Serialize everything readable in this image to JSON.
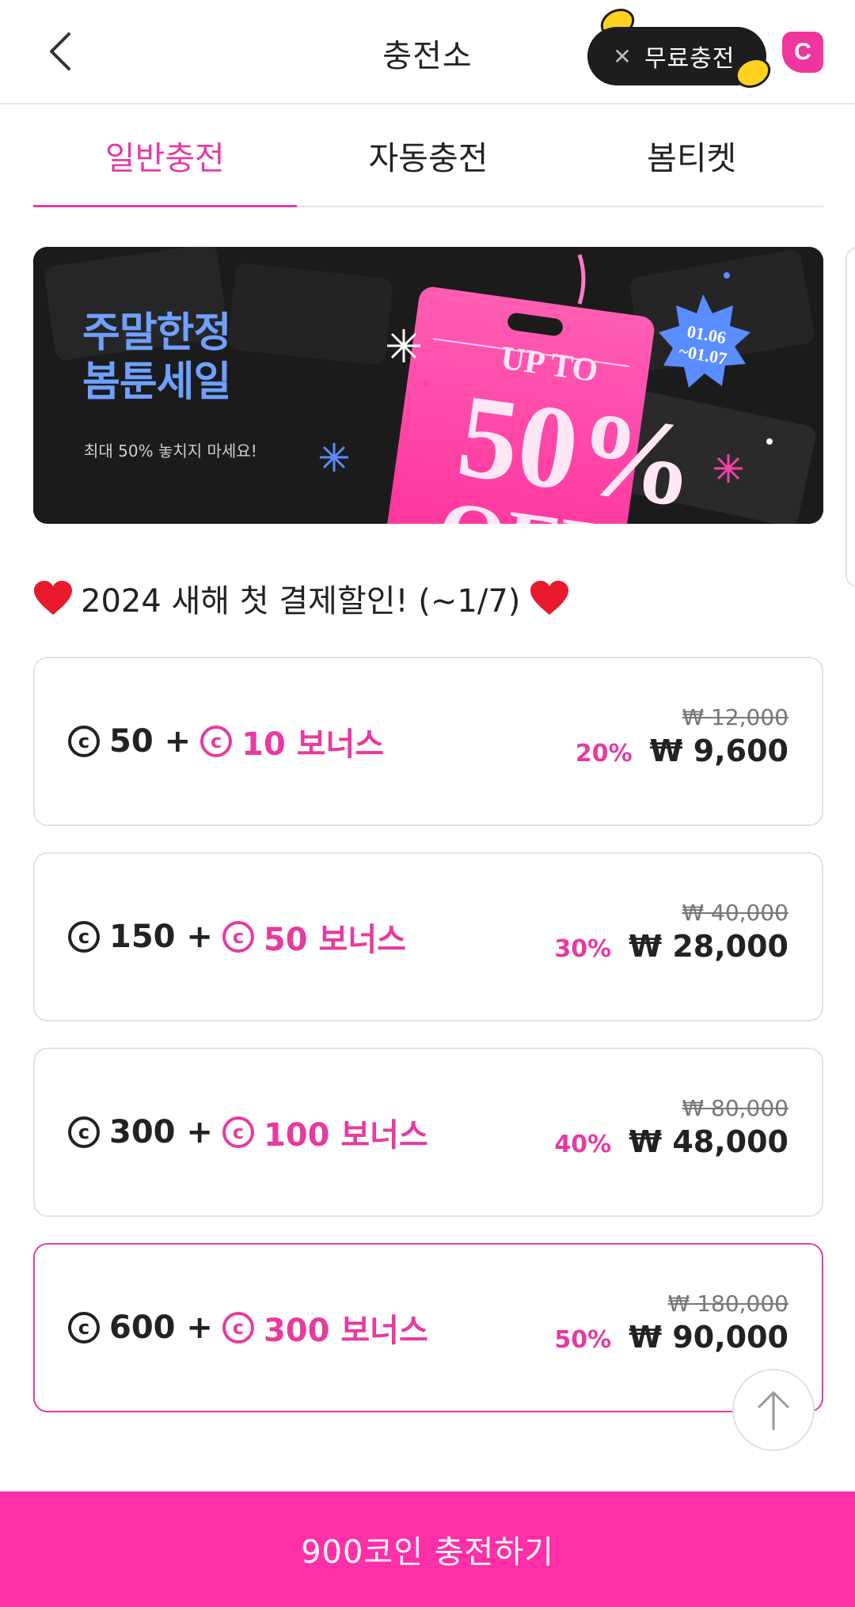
{
  "header": {
    "title": "충전소",
    "free_charge_label": "무료충전",
    "free_close": "✕",
    "brand_letter": "C"
  },
  "tabs": [
    {
      "label": "일반충전",
      "active": true
    },
    {
      "label": "자동충전",
      "active": false
    },
    {
      "label": "봄티켓",
      "active": false
    }
  ],
  "banner": {
    "title_line1": "주말한정",
    "title_line2": "봄툰세일",
    "subtitle": "최대 50% 놓치지 마세요!",
    "tag_text1": "UP TO",
    "tag_text2": "50%",
    "tag_text3": "OFF",
    "badge_line1": "01.06",
    "badge_line2": "~01.07"
  },
  "promo": {
    "text": "2024 새해 첫 결제할인! (~1/7)"
  },
  "packages": [
    {
      "coins": "50 +",
      "bonus": "10 보너스",
      "original": "₩ 12,000",
      "discount": "20%",
      "price": "₩ 9,600",
      "selected": false
    },
    {
      "coins": "150 +",
      "bonus": "50 보너스",
      "original": "₩ 40,000",
      "discount": "30%",
      "price": "₩ 28,000",
      "selected": false
    },
    {
      "coins": "300 +",
      "bonus": "100 보너스",
      "original": "₩ 80,000",
      "discount": "40%",
      "price": "₩ 48,000",
      "selected": false
    },
    {
      "coins": "600 +",
      "bonus": "300 보너스",
      "original": "₩ 180,000",
      "discount": "50%",
      "price": "₩ 90,000",
      "selected": true
    }
  ],
  "coin_symbol": "c",
  "cta": {
    "label": "900코인 충전하기"
  },
  "colors": {
    "accent": "#e83aa0",
    "cta": "#ff2fa8",
    "banner_title": "#6fa0ff"
  }
}
